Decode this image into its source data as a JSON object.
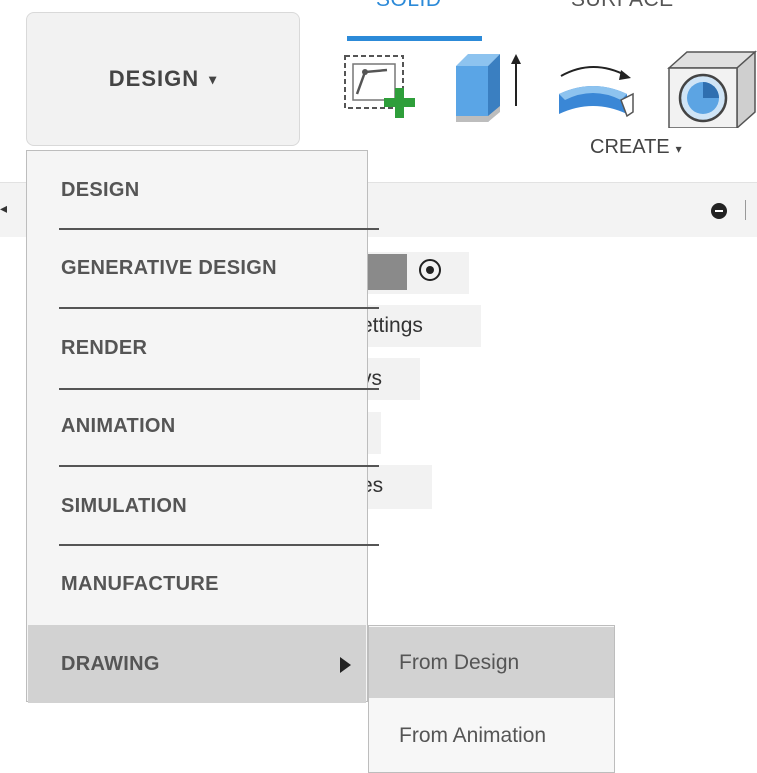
{
  "toolbar": {
    "workspace_button": "DESIGN",
    "workspace_caret": "▾",
    "tabs": [
      {
        "label": "SOLID",
        "active": true
      },
      {
        "label": "SURFACE",
        "active": false
      }
    ],
    "create_label": "CREATE",
    "create_caret": "▾",
    "icons": [
      "create-sketch-icon",
      "extrude-icon",
      "revolve-icon",
      "hole-icon"
    ],
    "accent_color": "#2c8ad8"
  },
  "browser": {
    "left_glyph": "◂",
    "tree_fragments": [
      {
        "text": ")",
        "has_eye": true
      },
      {
        "text": "ettings"
      },
      {
        "text": "vs"
      },
      {
        "text": ""
      },
      {
        "text": "es"
      }
    ]
  },
  "workspace_menu": {
    "items": [
      {
        "label": "DESIGN"
      },
      {
        "label": "GENERATIVE DESIGN"
      },
      {
        "label": "RENDER"
      },
      {
        "label": "ANIMATION"
      },
      {
        "label": "SIMULATION"
      },
      {
        "label": "MANUFACTURE"
      },
      {
        "label": "DRAWING",
        "has_submenu": true,
        "active": true
      }
    ]
  },
  "drawing_submenu": {
    "items": [
      {
        "label": "From Design",
        "hovered": true
      },
      {
        "label": "From Animation"
      }
    ]
  }
}
